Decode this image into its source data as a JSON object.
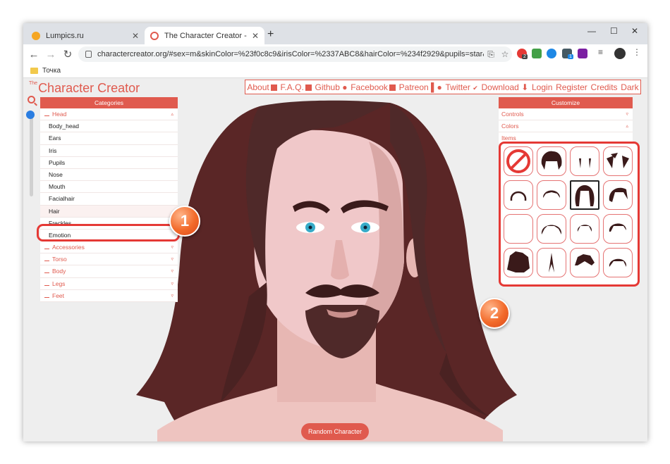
{
  "browser": {
    "tabs": [
      {
        "title": "Lumpics.ru",
        "active": false
      },
      {
        "title": "The Character Creator - Build visu",
        "active": true
      }
    ],
    "url": "charactercreator.org/#sex=m&skinColor=%23f0c8c9&irisColor=%2337ABC8&hairColor=%234f2929&pupils=star&ears=un...",
    "bookmark": "Точка",
    "extension_badges": [
      "2",
      "1"
    ]
  },
  "site": {
    "logo_small": "The",
    "logo": "Character Creator",
    "nav": [
      "About",
      "F.A.Q.",
      "Github",
      "Facebook",
      "Patreon",
      "Twitter",
      "Download",
      "Login",
      "Register",
      "Credits",
      "Dark"
    ]
  },
  "categories": {
    "header": "Categories",
    "head_group": "Head",
    "head_items": [
      "Body_head",
      "Ears",
      "Iris",
      "Pupils",
      "Nose",
      "Mouth",
      "Facialhair",
      "Hair",
      "Freckles",
      "Emotion"
    ],
    "groups": [
      "Accessories",
      "Torso",
      "Body",
      "Legs",
      "Feet"
    ]
  },
  "customize": {
    "header": "Customize",
    "rows": [
      "Controls",
      "Colors",
      "Items"
    ]
  },
  "annotations": {
    "one": "1",
    "two": "2"
  },
  "random_button": "Random Character",
  "colors": {
    "accent": "#e05a4e",
    "hair": "#4f2929",
    "skin": "#f0c8c9",
    "iris": "#37ABC8"
  }
}
